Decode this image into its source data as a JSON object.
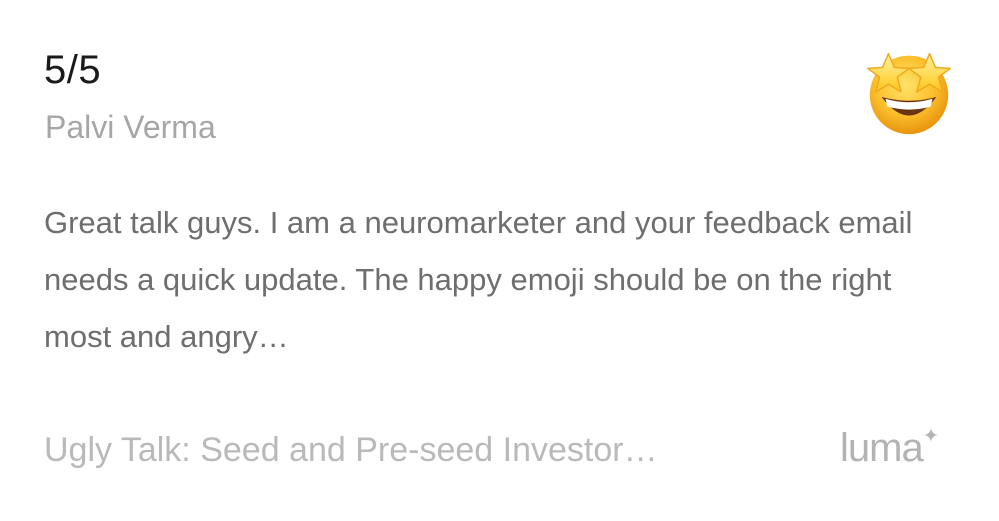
{
  "review": {
    "rating": "5/5",
    "author": "Palvi Verma",
    "emoji": "star-struck-emoji",
    "feedback": "Great talk guys. I am a neuromarketer and your feedback email needs a quick update. The happy emoji should be on the right most and angry…"
  },
  "footer": {
    "event_title": "Ugly Talk: Seed and Pre-seed Investor…",
    "brand": "luma",
    "brand_icon": "sparkle-icon"
  },
  "colors": {
    "rating_text": "#1a1a1a",
    "author_text": "#a6a6a6",
    "feedback_text": "#6e6e6e",
    "footer_text": "#b9b9b9",
    "emoji_face": "#f7b524",
    "emoji_stars": "#ffd93b"
  }
}
